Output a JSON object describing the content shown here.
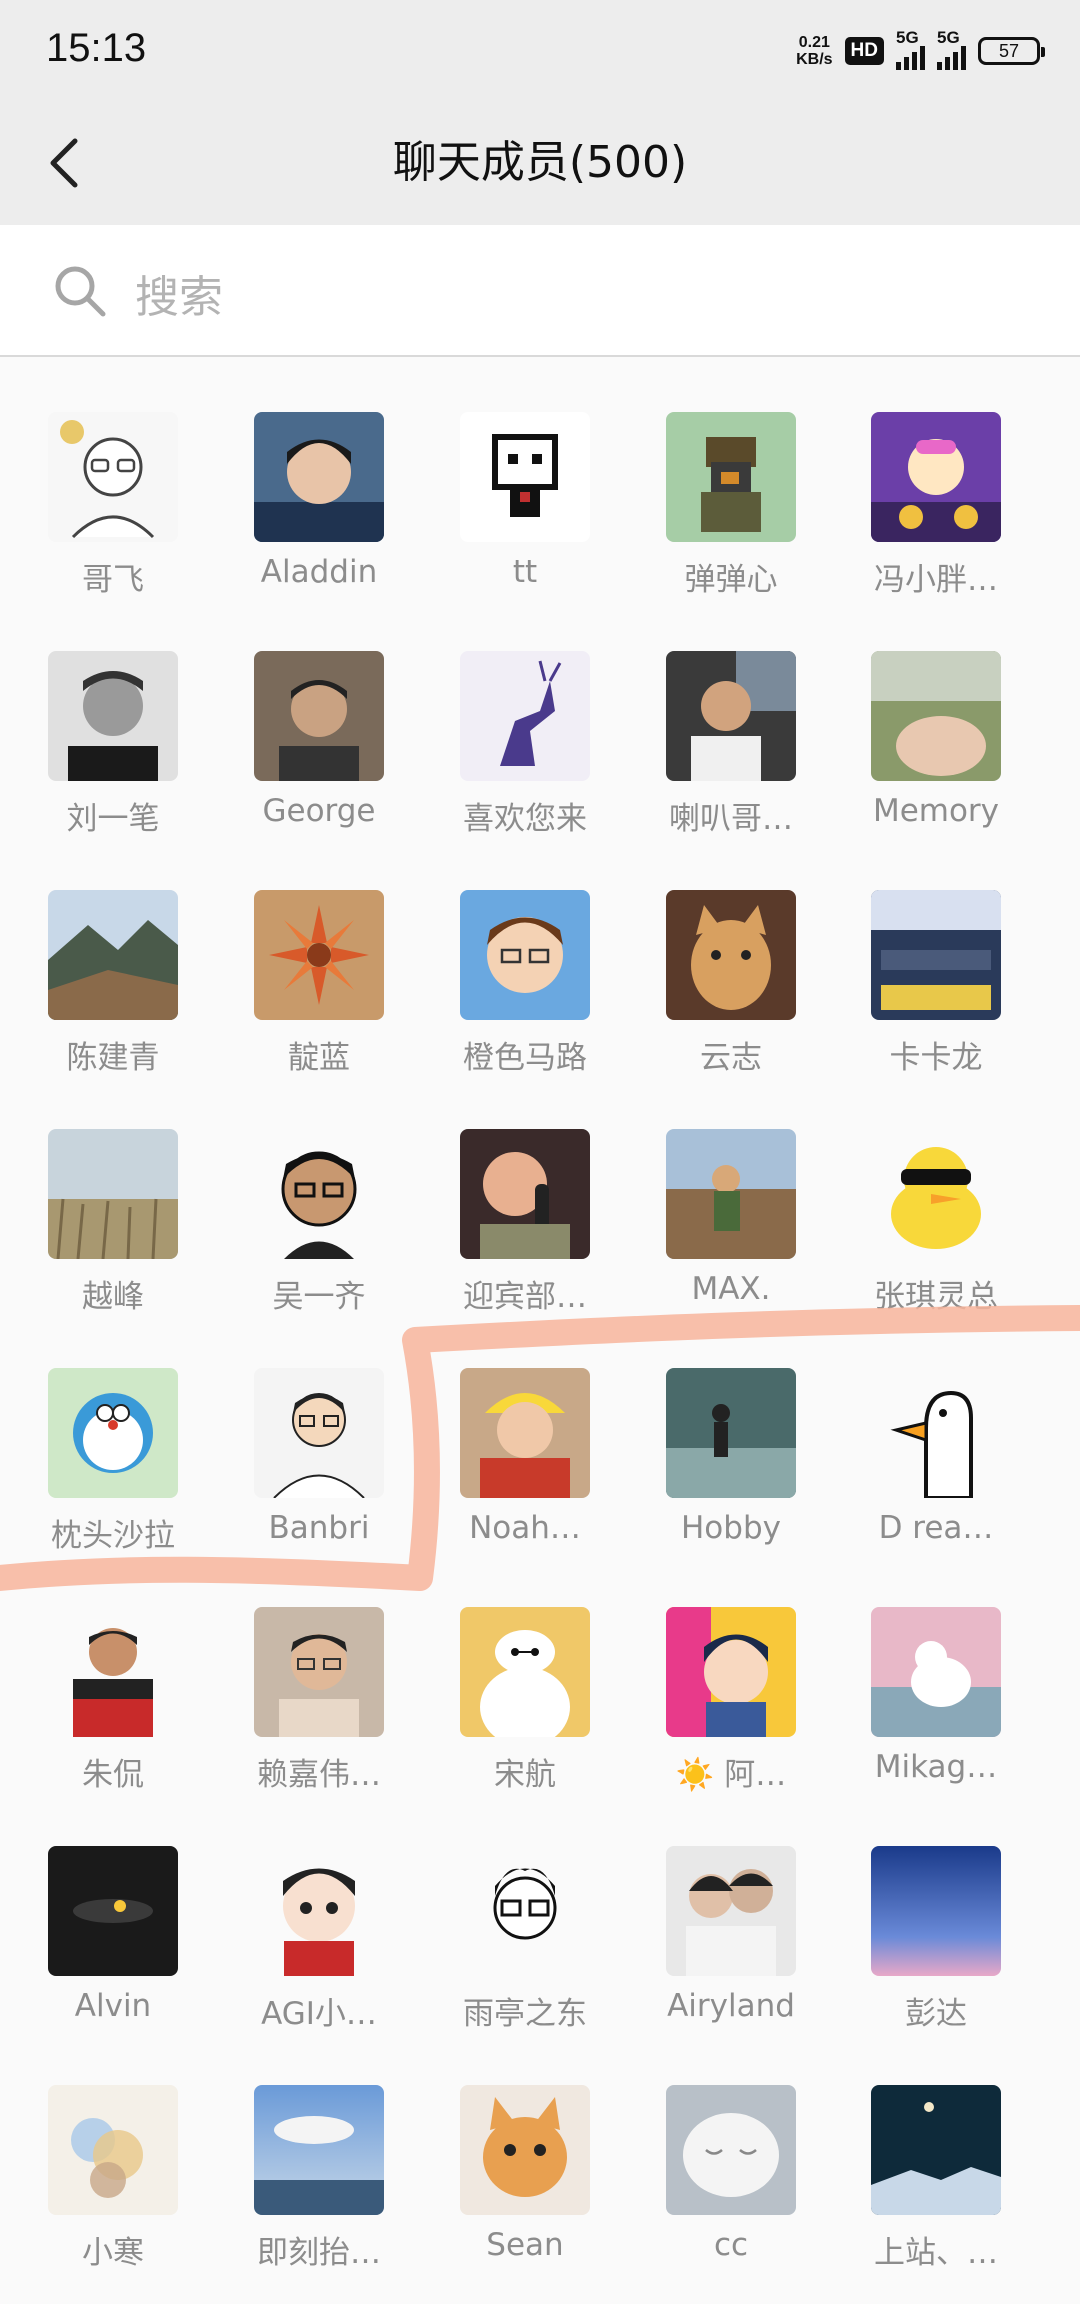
{
  "status_bar": {
    "time": "15:13",
    "net_speed_value": "0.21",
    "net_speed_unit": "KB/s",
    "hd_badge": "HD",
    "signal1_label": "5G",
    "signal2_label": "5G",
    "battery": "57"
  },
  "nav": {
    "title": "聊天成员(500)"
  },
  "search": {
    "placeholder": "搜索"
  },
  "members": [
    {
      "name": "哥飞",
      "avatar": "glasses-bald-cartoon"
    },
    {
      "name": "Aladdin",
      "avatar": "young-man-photo"
    },
    {
      "name": "tt",
      "avatar": "pixel-panda"
    },
    {
      "name": "弹弹心",
      "avatar": "pixel-soldier"
    },
    {
      "name": "冯小胖…",
      "avatar": "cartoon-scooter"
    },
    {
      "name": "刘一笔",
      "avatar": "man-bw-photo"
    },
    {
      "name": "George",
      "avatar": "man-photo"
    },
    {
      "name": "喜欢您来",
      "avatar": "purple-deer"
    },
    {
      "name": "喇叭哥…",
      "avatar": "man-car-photo"
    },
    {
      "name": "Memory",
      "avatar": "hand-outdoor-photo"
    },
    {
      "name": "陈建青",
      "avatar": "mountain-landscape"
    },
    {
      "name": "靛蓝",
      "avatar": "flower-pattern"
    },
    {
      "name": "橙色马路",
      "avatar": "cartoon-man-glasses"
    },
    {
      "name": "云志",
      "avatar": "cat-photo"
    },
    {
      "name": "卡卡龙",
      "avatar": "office-photo"
    },
    {
      "name": "越峰",
      "avatar": "reed-landscape"
    },
    {
      "name": "吴一齐",
      "avatar": "cartoon-man-sticker"
    },
    {
      "name": "迎宾部…",
      "avatar": "cartoon-microphone"
    },
    {
      "name": "MAX.",
      "avatar": "child-outdoor-photo"
    },
    {
      "name": "张琪灵总",
      "avatar": "duck-sunglasses"
    },
    {
      "name": "枕头沙拉",
      "avatar": "doraemon"
    },
    {
      "name": "Banbri",
      "avatar": "cartoon-man-white"
    },
    {
      "name": "Noah…",
      "avatar": "baby-yellow-hat"
    },
    {
      "name": "Hobby",
      "avatar": "walking-photo"
    },
    {
      "name": "D rea…",
      "avatar": "white-goose"
    },
    {
      "name": "朱侃",
      "avatar": "man-racing-suit"
    },
    {
      "name": "赖嘉伟…",
      "avatar": "man-glasses-photo"
    },
    {
      "name": "宋航",
      "avatar": "baymax"
    },
    {
      "name": "☀️ 阿…",
      "avatar": "anime-boy"
    },
    {
      "name": "Mikag…",
      "avatar": "dog-illustration"
    },
    {
      "name": "Alvin",
      "avatar": "dark-abstract"
    },
    {
      "name": "AGI小…",
      "avatar": "plush-doll"
    },
    {
      "name": "雨亭之东",
      "avatar": "cartoon-glasses-boy"
    },
    {
      "name": "Airyland",
      "avatar": "couple-photo"
    },
    {
      "name": "彭达",
      "avatar": "blue-sky-gradient"
    },
    {
      "name": "小寒",
      "avatar": "watercolor-art"
    },
    {
      "name": "即刻抬…",
      "avatar": "sea-sky-photo"
    },
    {
      "name": "Sean",
      "avatar": "orange-cat"
    },
    {
      "name": "cc",
      "avatar": "sleeping-cat"
    },
    {
      "name": "上站、…",
      "avatar": "night-moon-sea"
    }
  ],
  "colors": {
    "highlight_stroke": "#f7b49b",
    "name_text": "#8c8c8c",
    "header_bg": "#ededed"
  }
}
